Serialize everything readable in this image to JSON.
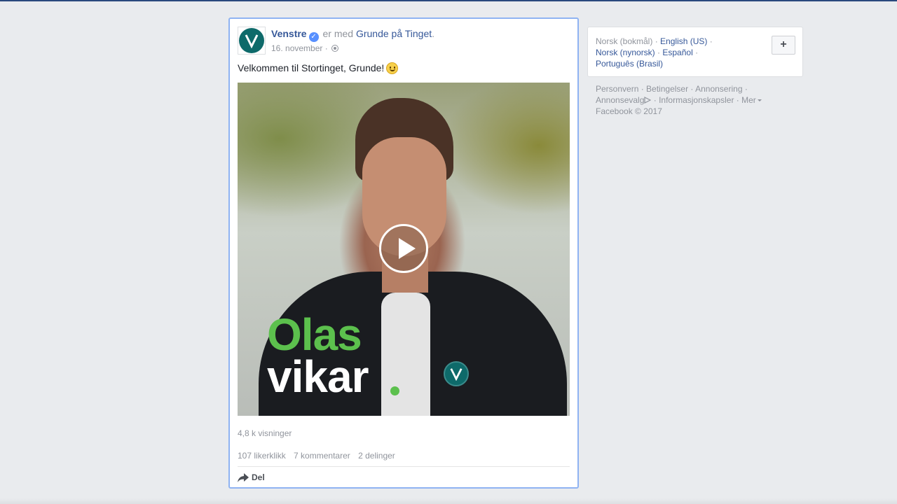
{
  "post": {
    "author": "Venstre",
    "with_text": "er med",
    "tagged_page": "Grunde på Tinget",
    "period": ".",
    "date": "16. november",
    "date_sep": "·",
    "message": "Velkommen til Stortinget, Grunde!",
    "video": {
      "line1": "Olas",
      "line2": "vikar"
    },
    "views": "4,8 k visninger",
    "likes": "107 likerklikk",
    "comments": "7 kommentarer",
    "shares": "2 delinger",
    "share_label": "Del"
  },
  "languages": {
    "current": "Norsk (bokmål)",
    "options": [
      "English (US)",
      "Norsk (nynorsk)",
      "Español",
      "Português (Brasil)"
    ],
    "sep": "·",
    "add_label": "+"
  },
  "footer": {
    "links": [
      "Personvern",
      "Betingelser",
      "Annonsering",
      "Annonsevalg",
      "Informasjonskapsler",
      "Mer"
    ],
    "copyright": "Facebook © 2017"
  },
  "colors": {
    "link": "#365899",
    "muted": "#90949c",
    "brand_green": "#5cc04d",
    "venstre_teal": "#0e6a6a",
    "page_bg": "#e9ebee"
  }
}
